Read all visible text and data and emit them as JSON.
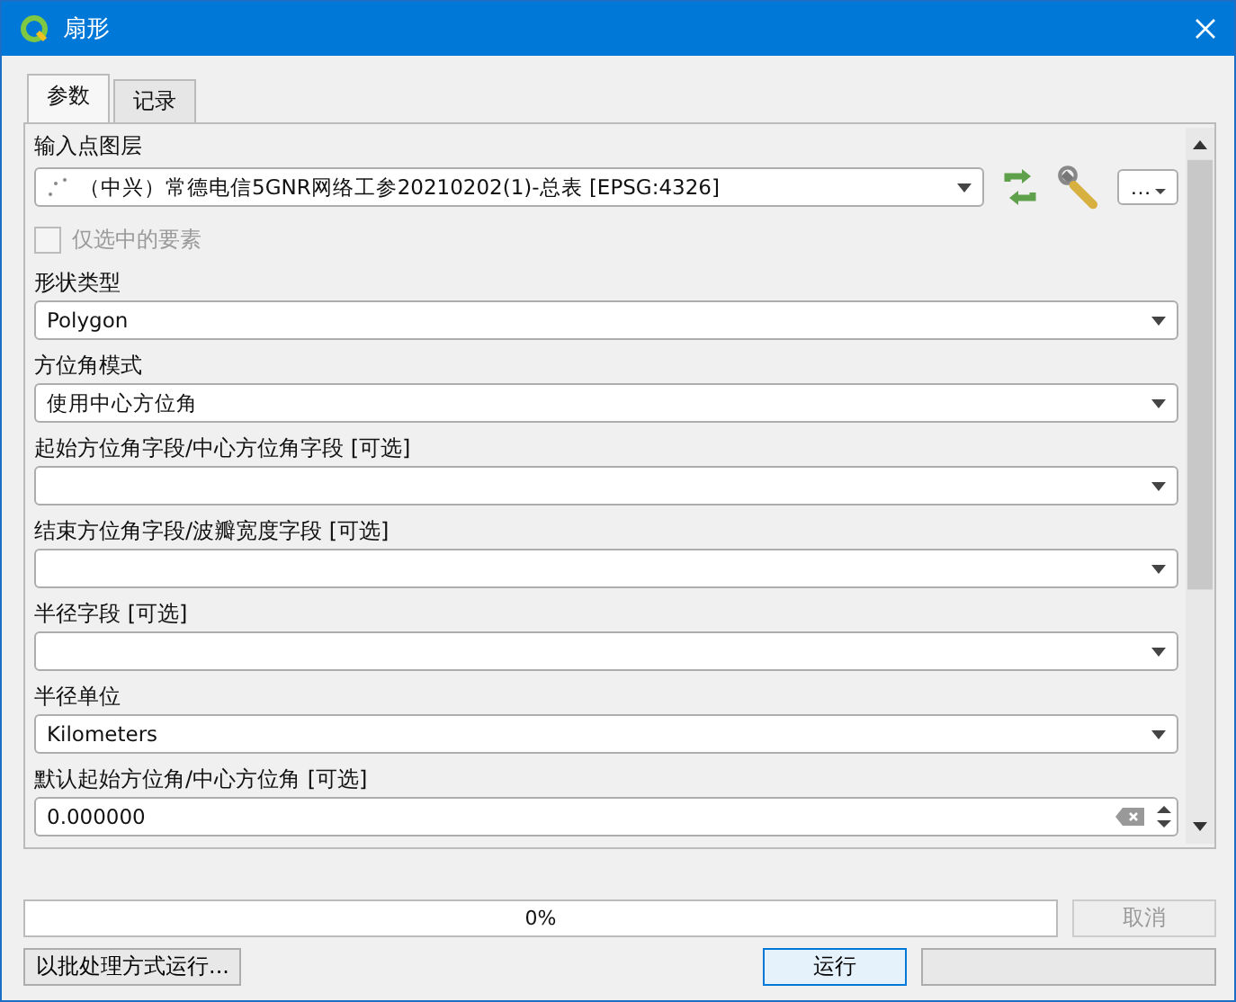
{
  "window": {
    "title": "扇形"
  },
  "tabs": [
    {
      "label": "参数",
      "selected": true
    },
    {
      "label": "记录",
      "selected": false
    }
  ],
  "params": [
    {
      "kind": "layer",
      "label": "输入点图层",
      "value": "（中兴）常德电信5GNR网络工参20210202(1)-总表 [EPSG:4326]",
      "more": "…"
    },
    {
      "kind": "checkbox",
      "label": "仅选中的要素",
      "checked": false,
      "disabled": true
    },
    {
      "kind": "combo",
      "label": "形状类型",
      "value": "Polygon"
    },
    {
      "kind": "combo",
      "label": "方位角模式",
      "value": "使用中心方位角"
    },
    {
      "kind": "combo",
      "label": "起始方位角字段/中心方位角字段 [可选]"
    },
    {
      "kind": "combo",
      "label": "结束方位角字段/波瓣宽度字段 [可选]"
    },
    {
      "kind": "combo",
      "label": "半径字段 [可选]"
    },
    {
      "kind": "combo",
      "label": "半径单位",
      "value": "Kilometers"
    },
    {
      "kind": "number",
      "label": "默认起始方位角/中心方位角 [可选]",
      "value": "0.000000"
    }
  ],
  "progress": {
    "level": 0,
    "text": "0%"
  },
  "cancel": {
    "label": "取消",
    "disabled": true
  },
  "batch": "以批处理方式运行...",
  "run": "运行"
}
